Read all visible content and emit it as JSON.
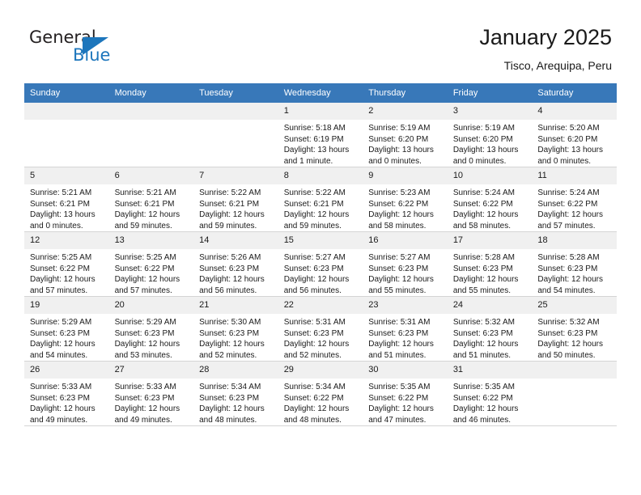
{
  "brand": {
    "name_top": "General",
    "name_bottom": "Blue",
    "triangle_icon": "blue-triangle-logo-mark",
    "accent_color": "#1d76bc"
  },
  "header": {
    "title": "January 2025",
    "subtitle": "Tisco, Arequipa, Peru"
  },
  "colors": {
    "header_row": "#3878b9",
    "daynum_band": "#f0f0f0",
    "grid_line": "#d4d4d4",
    "text": "#1a1a1a"
  },
  "weekdays": [
    "Sunday",
    "Monday",
    "Tuesday",
    "Wednesday",
    "Thursday",
    "Friday",
    "Saturday"
  ],
  "labels": {
    "sunrise": "Sunrise:",
    "sunset": "Sunset:",
    "daylight": "Daylight:"
  },
  "weeks": [
    [
      {
        "day": "",
        "empty": true
      },
      {
        "day": "",
        "empty": true
      },
      {
        "day": "",
        "empty": true
      },
      {
        "day": "1",
        "sunrise": "Sunrise: 5:18 AM",
        "sunset": "Sunset: 6:19 PM",
        "daylight": "Daylight: 13 hours and 1 minute."
      },
      {
        "day": "2",
        "sunrise": "Sunrise: 5:19 AM",
        "sunset": "Sunset: 6:20 PM",
        "daylight": "Daylight: 13 hours and 0 minutes."
      },
      {
        "day": "3",
        "sunrise": "Sunrise: 5:19 AM",
        "sunset": "Sunset: 6:20 PM",
        "daylight": "Daylight: 13 hours and 0 minutes."
      },
      {
        "day": "4",
        "sunrise": "Sunrise: 5:20 AM",
        "sunset": "Sunset: 6:20 PM",
        "daylight": "Daylight: 13 hours and 0 minutes."
      }
    ],
    [
      {
        "day": "5",
        "sunrise": "Sunrise: 5:21 AM",
        "sunset": "Sunset: 6:21 PM",
        "daylight": "Daylight: 13 hours and 0 minutes."
      },
      {
        "day": "6",
        "sunrise": "Sunrise: 5:21 AM",
        "sunset": "Sunset: 6:21 PM",
        "daylight": "Daylight: 12 hours and 59 minutes."
      },
      {
        "day": "7",
        "sunrise": "Sunrise: 5:22 AM",
        "sunset": "Sunset: 6:21 PM",
        "daylight": "Daylight: 12 hours and 59 minutes."
      },
      {
        "day": "8",
        "sunrise": "Sunrise: 5:22 AM",
        "sunset": "Sunset: 6:21 PM",
        "daylight": "Daylight: 12 hours and 59 minutes."
      },
      {
        "day": "9",
        "sunrise": "Sunrise: 5:23 AM",
        "sunset": "Sunset: 6:22 PM",
        "daylight": "Daylight: 12 hours and 58 minutes."
      },
      {
        "day": "10",
        "sunrise": "Sunrise: 5:24 AM",
        "sunset": "Sunset: 6:22 PM",
        "daylight": "Daylight: 12 hours and 58 minutes."
      },
      {
        "day": "11",
        "sunrise": "Sunrise: 5:24 AM",
        "sunset": "Sunset: 6:22 PM",
        "daylight": "Daylight: 12 hours and 57 minutes."
      }
    ],
    [
      {
        "day": "12",
        "sunrise": "Sunrise: 5:25 AM",
        "sunset": "Sunset: 6:22 PM",
        "daylight": "Daylight: 12 hours and 57 minutes."
      },
      {
        "day": "13",
        "sunrise": "Sunrise: 5:25 AM",
        "sunset": "Sunset: 6:22 PM",
        "daylight": "Daylight: 12 hours and 57 minutes."
      },
      {
        "day": "14",
        "sunrise": "Sunrise: 5:26 AM",
        "sunset": "Sunset: 6:23 PM",
        "daylight": "Daylight: 12 hours and 56 minutes."
      },
      {
        "day": "15",
        "sunrise": "Sunrise: 5:27 AM",
        "sunset": "Sunset: 6:23 PM",
        "daylight": "Daylight: 12 hours and 56 minutes."
      },
      {
        "day": "16",
        "sunrise": "Sunrise: 5:27 AM",
        "sunset": "Sunset: 6:23 PM",
        "daylight": "Daylight: 12 hours and 55 minutes."
      },
      {
        "day": "17",
        "sunrise": "Sunrise: 5:28 AM",
        "sunset": "Sunset: 6:23 PM",
        "daylight": "Daylight: 12 hours and 55 minutes."
      },
      {
        "day": "18",
        "sunrise": "Sunrise: 5:28 AM",
        "sunset": "Sunset: 6:23 PM",
        "daylight": "Daylight: 12 hours and 54 minutes."
      }
    ],
    [
      {
        "day": "19",
        "sunrise": "Sunrise: 5:29 AM",
        "sunset": "Sunset: 6:23 PM",
        "daylight": "Daylight: 12 hours and 54 minutes."
      },
      {
        "day": "20",
        "sunrise": "Sunrise: 5:29 AM",
        "sunset": "Sunset: 6:23 PM",
        "daylight": "Daylight: 12 hours and 53 minutes."
      },
      {
        "day": "21",
        "sunrise": "Sunrise: 5:30 AM",
        "sunset": "Sunset: 6:23 PM",
        "daylight": "Daylight: 12 hours and 52 minutes."
      },
      {
        "day": "22",
        "sunrise": "Sunrise: 5:31 AM",
        "sunset": "Sunset: 6:23 PM",
        "daylight": "Daylight: 12 hours and 52 minutes."
      },
      {
        "day": "23",
        "sunrise": "Sunrise: 5:31 AM",
        "sunset": "Sunset: 6:23 PM",
        "daylight": "Daylight: 12 hours and 51 minutes."
      },
      {
        "day": "24",
        "sunrise": "Sunrise: 5:32 AM",
        "sunset": "Sunset: 6:23 PM",
        "daylight": "Daylight: 12 hours and 51 minutes."
      },
      {
        "day": "25",
        "sunrise": "Sunrise: 5:32 AM",
        "sunset": "Sunset: 6:23 PM",
        "daylight": "Daylight: 12 hours and 50 minutes."
      }
    ],
    [
      {
        "day": "26",
        "sunrise": "Sunrise: 5:33 AM",
        "sunset": "Sunset: 6:23 PM",
        "daylight": "Daylight: 12 hours and 49 minutes."
      },
      {
        "day": "27",
        "sunrise": "Sunrise: 5:33 AM",
        "sunset": "Sunset: 6:23 PM",
        "daylight": "Daylight: 12 hours and 49 minutes."
      },
      {
        "day": "28",
        "sunrise": "Sunrise: 5:34 AM",
        "sunset": "Sunset: 6:23 PM",
        "daylight": "Daylight: 12 hours and 48 minutes."
      },
      {
        "day": "29",
        "sunrise": "Sunrise: 5:34 AM",
        "sunset": "Sunset: 6:22 PM",
        "daylight": "Daylight: 12 hours and 48 minutes."
      },
      {
        "day": "30",
        "sunrise": "Sunrise: 5:35 AM",
        "sunset": "Sunset: 6:22 PM",
        "daylight": "Daylight: 12 hours and 47 minutes."
      },
      {
        "day": "31",
        "sunrise": "Sunrise: 5:35 AM",
        "sunset": "Sunset: 6:22 PM",
        "daylight": "Daylight: 12 hours and 46 minutes."
      },
      {
        "day": "",
        "empty": true
      }
    ]
  ]
}
